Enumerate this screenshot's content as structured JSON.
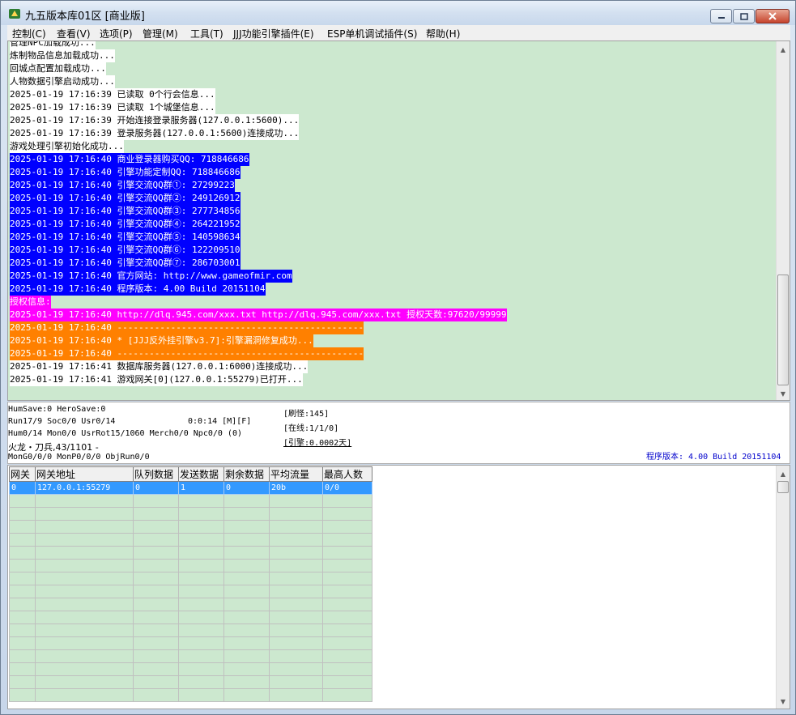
{
  "window": {
    "title": "九五版本库01区 [商业版]"
  },
  "menu": [
    "控制(C)",
    "查看(V)",
    "选项(P)",
    "管理(M)",
    "工具(T)",
    "JJJ功能引擎插件(E)",
    "ESP单机调试插件(S)",
    "帮助(H)"
  ],
  "log": [
    {
      "text": "管理NPC加载成功...",
      "color": "white"
    },
    {
      "text": "炼制物品信息加载成功...",
      "color": "white"
    },
    {
      "text": "回城点配置加载成功...",
      "color": "white"
    },
    {
      "text": "人物数据引擎启动成功...",
      "color": "white"
    },
    {
      "text": "2025-01-19 17:16:39 已读取 0个行会信息...",
      "color": "white"
    },
    {
      "text": "2025-01-19 17:16:39 已读取 1个城堡信息...",
      "color": "white"
    },
    {
      "text": "2025-01-19 17:16:39 开始连接登录服务器(127.0.0.1:5600)...",
      "color": "white"
    },
    {
      "text": "2025-01-19 17:16:39 登录服务器(127.0.0.1:5600)连接成功...",
      "color": "white"
    },
    {
      "text": "游戏处理引擎初始化成功...",
      "color": "white"
    },
    {
      "text": "2025-01-19 17:16:40 商业登录器购买QQ: 718846686",
      "color": "blue"
    },
    {
      "text": "2025-01-19 17:16:40 引擎功能定制QQ: 718846686",
      "color": "blue"
    },
    {
      "text": "2025-01-19 17:16:40 引擎交流QQ群①: 27299223",
      "color": "blue"
    },
    {
      "text": "2025-01-19 17:16:40 引擎交流QQ群②: 249126912",
      "color": "blue"
    },
    {
      "text": "2025-01-19 17:16:40 引擎交流QQ群③: 277734856",
      "color": "blue"
    },
    {
      "text": "2025-01-19 17:16:40 引擎交流QQ群④: 264221952",
      "color": "blue"
    },
    {
      "text": "2025-01-19 17:16:40 引擎交流QQ群⑤: 140598634",
      "color": "blue"
    },
    {
      "text": "2025-01-19 17:16:40 引擎交流QQ群⑥: 122209510",
      "color": "blue"
    },
    {
      "text": "2025-01-19 17:16:40 引擎交流QQ群⑦: 286703001",
      "color": "blue"
    },
    {
      "text": "2025-01-19 17:16:40 官方网站: http://www.gameofmir.com",
      "color": "blue"
    },
    {
      "text": "2025-01-19 17:16:40 程序版本: 4.00 Build 20151104",
      "color": "blue"
    },
    {
      "text": "授权信息:",
      "color": "magenta"
    },
    {
      "text": "2025-01-19 17:16:40 http://dlq.945.com/xxx.txt http://dlq.945.com/xxx.txt 授权天数:97620/99999",
      "color": "magenta"
    },
    {
      "text": "2025-01-19 17:16:40 ----------------------------------------------",
      "color": "orange"
    },
    {
      "text": "2025-01-19 17:16:40 * [JJJ反外挂引擎v3.7]:引擎漏洞修复成功...",
      "color": "orange"
    },
    {
      "text": "2025-01-19 17:16:40 ----------------------------------------------",
      "color": "orange"
    },
    {
      "text": "2025-01-19 17:16:41 数据库服务器(127.0.0.1:6000)连接成功...",
      "color": "white"
    },
    {
      "text": "2025-01-19 17:16:41 游戏网关[0](127.0.0.1:55279)已打开...",
      "color": "white"
    }
  ],
  "status": {
    "line1": "HumSave:0 HeroSave:0",
    "line2": "Run17/9 Soc0/0 Usr0/14",
    "time": "0:0:14 [M][F]",
    "line3": "Hum0/14 Mon0/0 UsrRot15/1060 Merch0/0 Npc0/0 (0)",
    "line4": "火龙・刀兵,43/1101 -",
    "line5": "MonG0/0/0 MonP0/0/0 ObjRun0/0",
    "refresh": "[刷怪:145]",
    "online": "[在线:1/1/0]",
    "engine": "[引擎:0.0002天]",
    "version": "程序版本: 4.00 Build 20151104"
  },
  "gateway_table": {
    "headers": [
      "网关",
      "网关地址",
      "队列数据",
      "发送数据",
      "剩余数据",
      "平均流量",
      "最高人数"
    ],
    "rows": [
      [
        "0",
        "127.0.0.1:55279",
        "0",
        "1",
        "0",
        "20b",
        "0/0"
      ]
    ]
  }
}
